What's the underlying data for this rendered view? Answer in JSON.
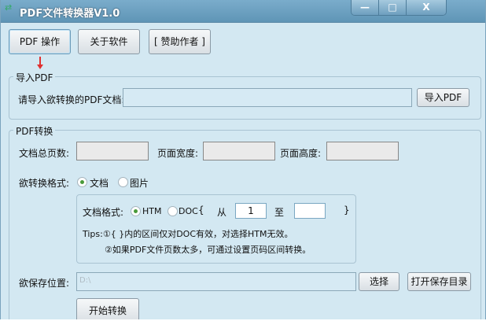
{
  "window": {
    "title": "PDF文件转换器V1.0",
    "minimize": "—",
    "maximize": "□",
    "close": "X"
  },
  "toolbar": {
    "pdf_ops": "PDF 操作",
    "about": "关于软件",
    "sponsor": "[ 赞助作者 ]"
  },
  "import": {
    "group_label": "导入PDF",
    "prompt": "请导入欲转换的PDF文档:",
    "file_value": "",
    "button": "导入PDF"
  },
  "convert": {
    "group_label": "PDF转换",
    "total_pages_label": "文档总页数:",
    "page_width_label": "页面宽度:",
    "page_height_label": "页面高度:",
    "total_pages": "",
    "page_width": "",
    "page_height": "",
    "format_label": "欲转换格式:",
    "format_options": [
      "文档",
      "图片"
    ],
    "format_selected": "文档",
    "doc_format_label": "文档格式:",
    "doc_format_options": [
      "HTM",
      "DOC"
    ],
    "doc_format_selected": "HTM",
    "brace_open": "{",
    "from_label": "从",
    "from_value": "1",
    "to_label": "至",
    "to_value": "",
    "brace_close": "}",
    "tip1": "Tips:①{ }内的区间仅对DOC有效，对选择HTM无效。",
    "tip2": "②如果PDF文件页数太多，可通过设置页码区间转换。",
    "save_label": "欲保存位置:",
    "save_path": "D:\\",
    "choose_button": "选择",
    "open_dir_button": "打开保存目录",
    "start_button": "开始转换"
  }
}
